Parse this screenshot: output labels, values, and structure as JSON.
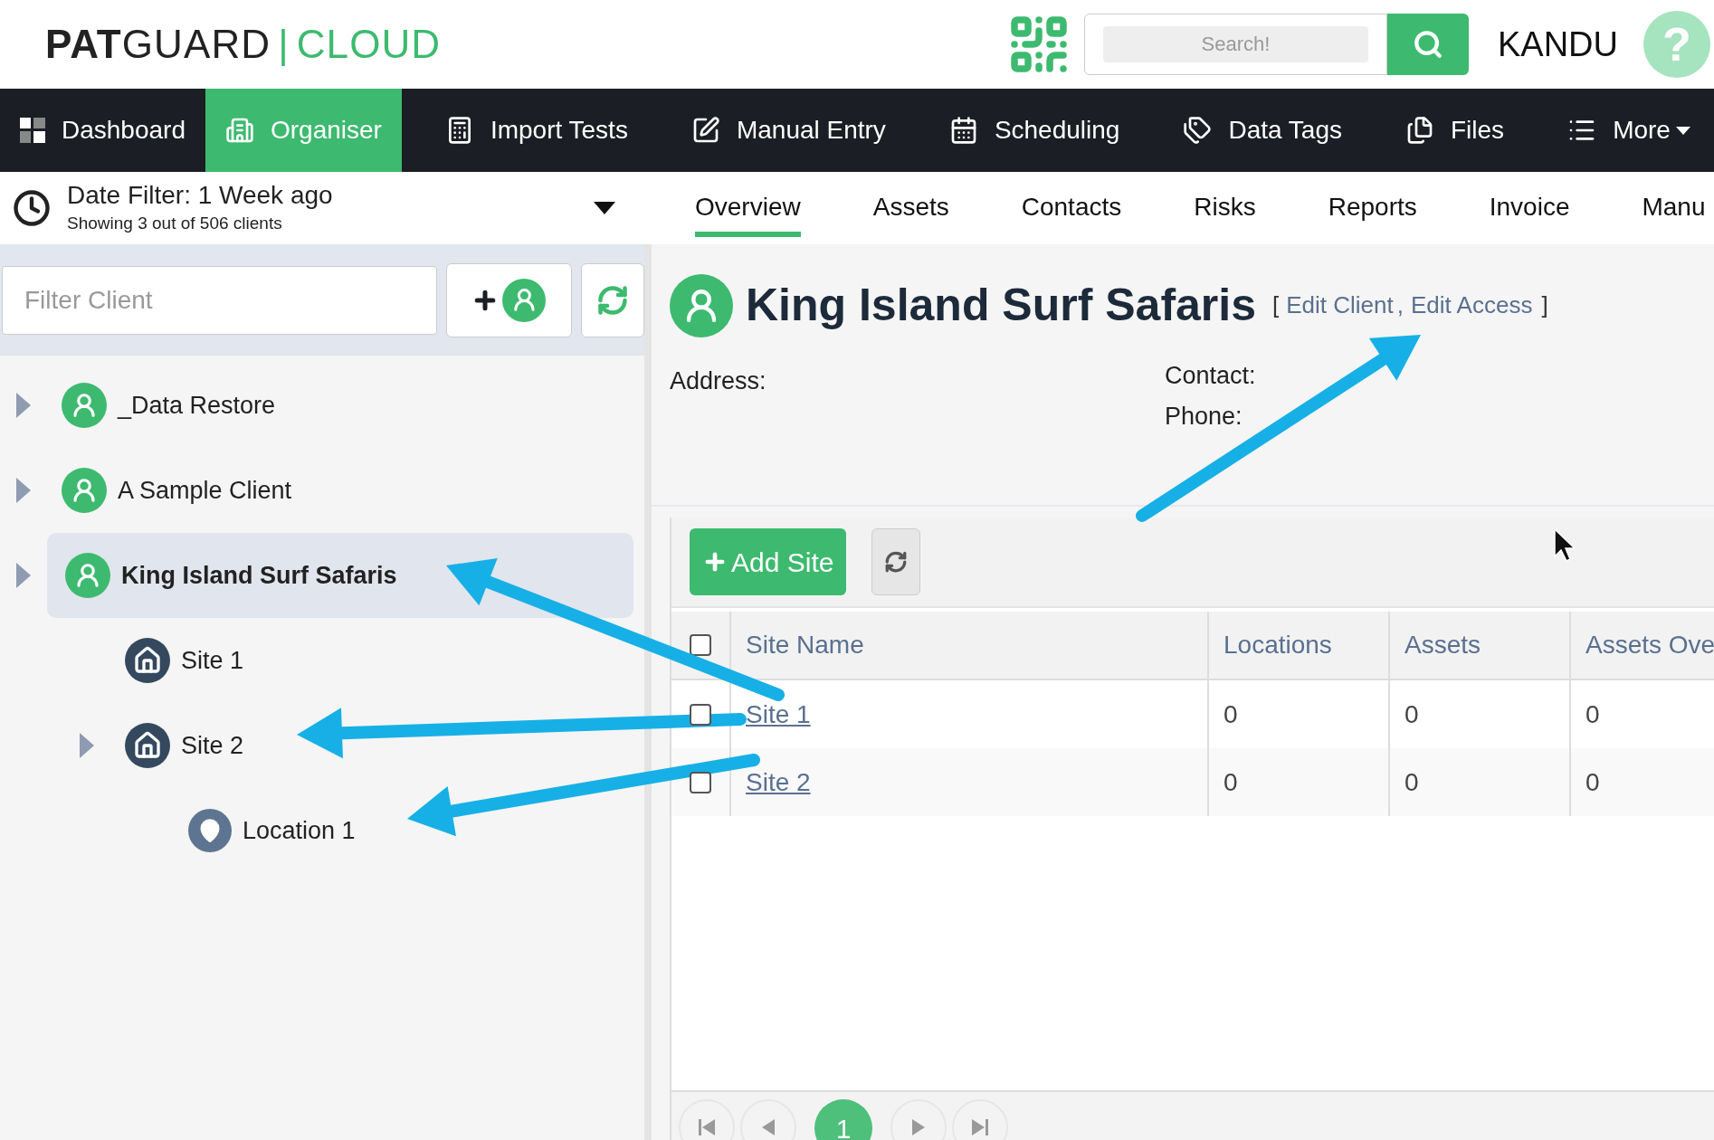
{
  "header": {
    "logo_bold": "PAT",
    "logo_light": "GUARD",
    "logo_divider": "|",
    "logo_accent": "CLOUD",
    "search": {
      "placeholder": "Search!"
    },
    "user": "KANDU",
    "help": "?"
  },
  "nav": [
    {
      "label": "Dashboard",
      "selected": false,
      "dropdown": false
    },
    {
      "label": "Organiser",
      "selected": true,
      "dropdown": false
    },
    {
      "label": "Import Tests",
      "selected": false,
      "dropdown": false
    },
    {
      "label": "Manual Entry",
      "selected": false,
      "dropdown": false
    },
    {
      "label": "Scheduling",
      "selected": false,
      "dropdown": false
    },
    {
      "label": "Data Tags",
      "selected": false,
      "dropdown": false
    },
    {
      "label": "Files",
      "selected": false,
      "dropdown": false
    },
    {
      "label": "More",
      "selected": false,
      "dropdown": true
    }
  ],
  "date_filter": {
    "title": "Date Filter: 1 Week ago",
    "subtitle": "Showing 3 out of 506 clients"
  },
  "sub_tabs": [
    {
      "label": "Overview",
      "selected": true
    },
    {
      "label": "Assets",
      "selected": false
    },
    {
      "label": "Contacts",
      "selected": false
    },
    {
      "label": "Risks",
      "selected": false
    },
    {
      "label": "Reports",
      "selected": false
    },
    {
      "label": "Invoice",
      "selected": false
    },
    {
      "label": "Manu",
      "selected": false
    }
  ],
  "client_filter": {
    "placeholder": "Filter Client"
  },
  "tree": [
    {
      "label": "_Data Restore",
      "kind": "client",
      "expandable": true,
      "selected": false
    },
    {
      "label": "A Sample Client",
      "kind": "client",
      "expandable": true,
      "selected": false
    },
    {
      "label": "King Island Surf Safaris",
      "kind": "client",
      "expandable": true,
      "selected": true,
      "children": [
        {
          "label": "Site 1",
          "kind": "site",
          "expandable": false,
          "selected": false
        },
        {
          "label": "Site 2",
          "kind": "site",
          "expandable": true,
          "selected": false,
          "children": [
            {
              "label": "Location 1",
              "kind": "location",
              "expandable": false,
              "selected": false
            }
          ]
        }
      ]
    }
  ],
  "client": {
    "name": "King Island Surf Safaris",
    "bracket_open": "[",
    "links": [
      "Edit Client",
      "Edit Access"
    ],
    "separator": ",",
    "bracket_close": "]",
    "address_label": "Address:",
    "contact_label": "Contact:",
    "phone_label": "Phone:"
  },
  "sites": {
    "add_button": "Add Site",
    "select_all": {
      "checked": false
    },
    "columns": [
      "Site Name",
      "Locations",
      "Assets",
      "Assets Ove"
    ],
    "rows": [
      {
        "checked": false,
        "cells": [
          "Site 1",
          "0",
          "0",
          "0"
        ]
      },
      {
        "checked": false,
        "cells": [
          "Site 2",
          "0",
          "0",
          "0"
        ]
      }
    ],
    "pages": [
      {
        "label": "1",
        "selected": true
      }
    ]
  }
}
